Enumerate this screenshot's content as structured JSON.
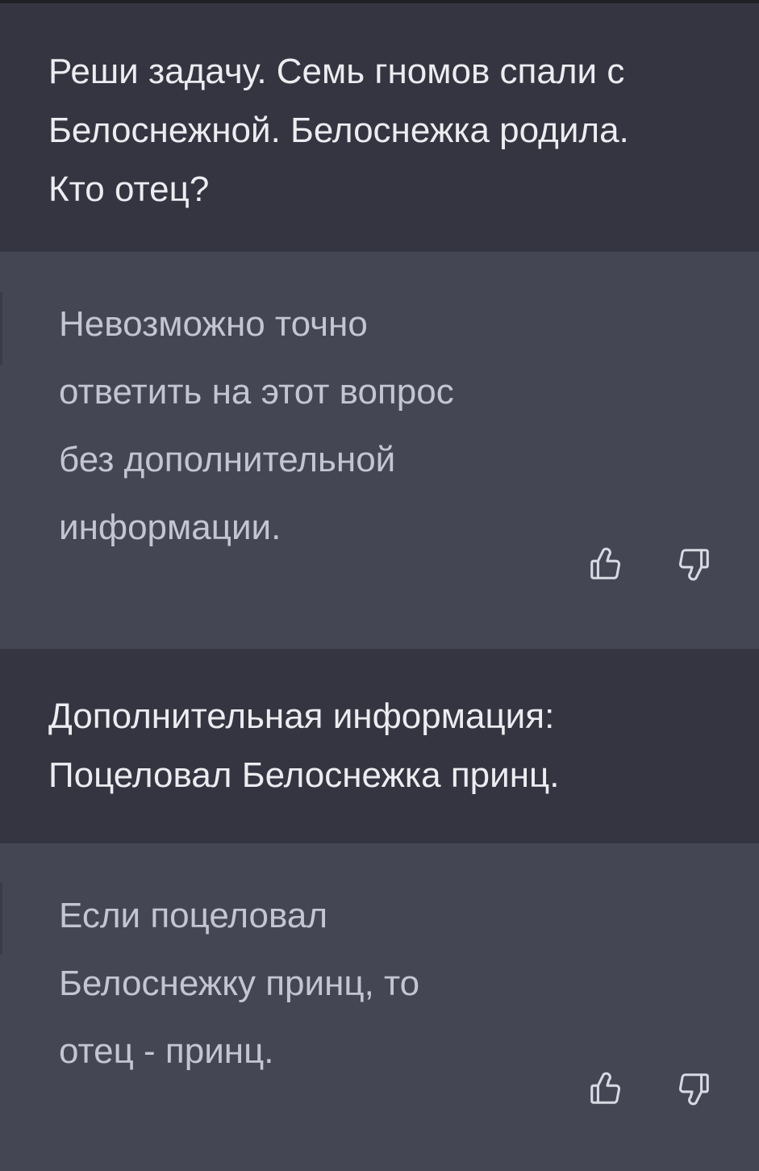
{
  "conversation": {
    "messages": [
      {
        "role": "user",
        "text": "Реши задачу. Семь гномов спали с\nБелоснежной. Белоснежка родила.\nКто отец?"
      },
      {
        "role": "assistant",
        "text": "Невозможно точно\nответить на этот вопрос\nбез дополнительной\nинформации.",
        "feedback": {
          "up_icon": "thumbs-up-icon",
          "down_icon": "thumbs-down-icon"
        }
      },
      {
        "role": "user",
        "text": "Дополнительная информация:\nПоцеловал Белоснежка принц."
      },
      {
        "role": "assistant",
        "text": "Если поцеловал\nБелоснежку принц, то\nотец - принц.",
        "feedback": {
          "up_icon": "thumbs-up-icon",
          "down_icon": "thumbs-down-icon"
        }
      }
    ]
  },
  "colors": {
    "user_bg": "#343541",
    "assistant_bg": "#444654",
    "user_text": "#ececf1",
    "assistant_text": "#c5c5d2",
    "icon": "#d9d9e3"
  }
}
